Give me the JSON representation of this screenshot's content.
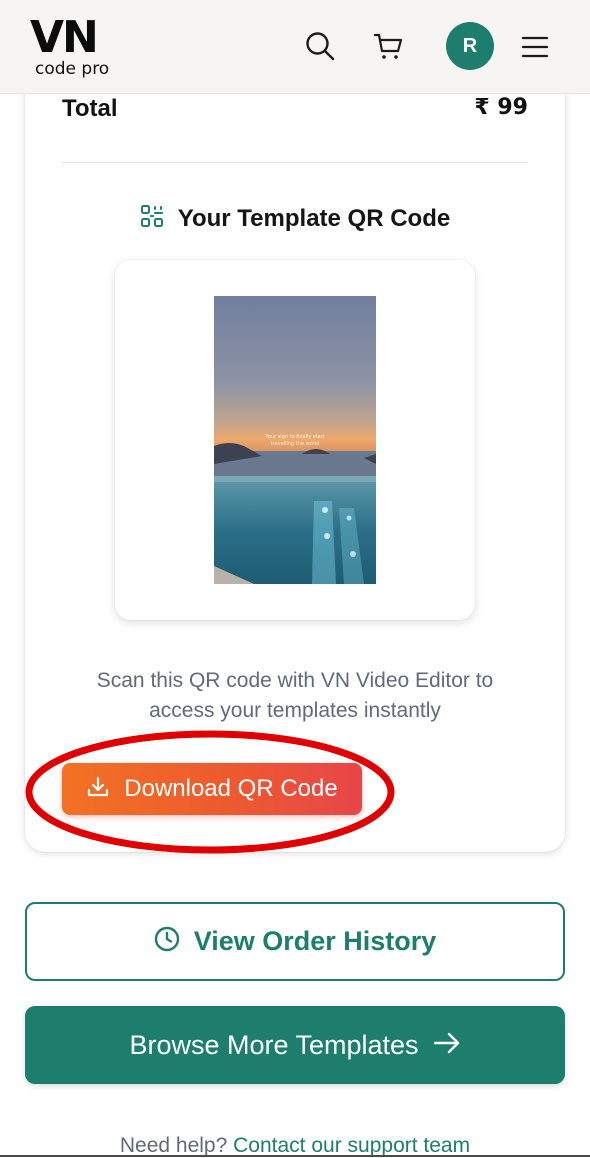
{
  "header": {
    "logo_main": "VN",
    "logo_sub": "code pro",
    "avatar_initial": "R"
  },
  "order": {
    "total_label": "Total",
    "total_value": "₹ 99"
  },
  "qr": {
    "heading": "Your Template QR Code",
    "image_caption_line1": "Your sign to finally start",
    "image_caption_line2": "travelling the world",
    "scan_instructions": "Scan this QR code with VN Video Editor to access your templates instantly",
    "download_label": "Download QR Code"
  },
  "actions": {
    "history_label": "View Order History",
    "browse_label": "Browse More Templates"
  },
  "help": {
    "prefix": "Need help?",
    "link": "Contact our support team"
  },
  "icons": {
    "search": "search-icon",
    "cart": "cart-icon",
    "menu": "hamburger-menu-icon",
    "qr": "qr-code-icon",
    "download": "download-icon",
    "clock": "clock-icon",
    "arrow": "arrow-right-icon"
  },
  "colors": {
    "brand_teal": "#1d7e6e",
    "download_orange": "#f27223",
    "download_red": "#e8454a",
    "annotation_red": "#e00000",
    "header_bg": "#f6f5f3",
    "muted_text": "#5f6b78"
  }
}
